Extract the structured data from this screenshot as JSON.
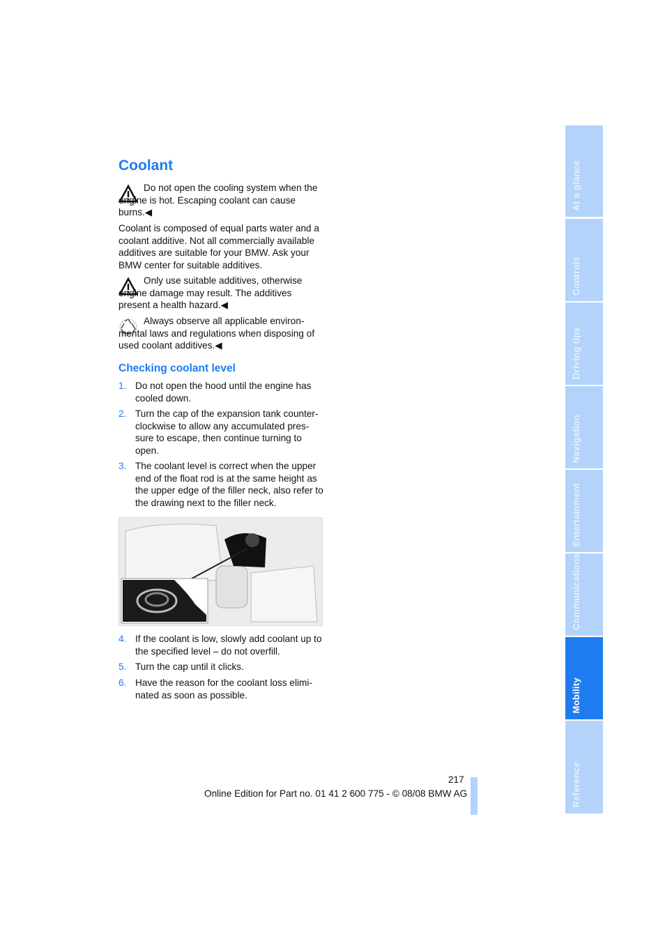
{
  "title": "Coolant",
  "warning1": "Do not open the cooling system when the engine is hot. Escaping coolant can cause burns.◀",
  "para1": "Coolant is composed of equal parts water and a coolant additive. Not all commercially available additives are suitable for your BMW. Ask your BMW center for suitable additives.",
  "warning2": "Only use suitable additives, otherwise engine damage may result. The additives present a health hazard.◀",
  "env_note": "Always observe all applicable environ­mental laws and regulations when dis­posing of used coolant additives.◀",
  "subtitle": "Checking coolant level",
  "steps": [
    {
      "n": "1.",
      "text": "Do not open the hood until the engine has cooled down."
    },
    {
      "n": "2.",
      "text": "Turn the cap of the expansion tank counter­clockwise to allow any accumulated pres­sure to escape, then continue turning to open."
    },
    {
      "n": "3.",
      "text": "The coolant level is correct when the upper end of the float rod is at the same height as the upper edge of the filler neck, also refer to the drawing next to the filler neck."
    },
    {
      "n": "4.",
      "text": "If the coolant is low, slowly add coolant up to the specified level – do not overfill."
    },
    {
      "n": "5.",
      "text": "Turn the cap until it clicks."
    },
    {
      "n": "6.",
      "text": "Have the reason for the coolant loss elimi­nated as soon as possible."
    }
  ],
  "page_number": "217",
  "footer": "Online Edition for Part no. 01 41 2 600 775 - © 08/08 BMW AG",
  "tabs": [
    {
      "label": "At a glance",
      "active": false
    },
    {
      "label": "Controls",
      "active": false
    },
    {
      "label": "Driving tips",
      "active": false
    },
    {
      "label": "Navigation",
      "active": false
    },
    {
      "label": "Entertainment",
      "active": false
    },
    {
      "label": "Communications",
      "active": false
    },
    {
      "label": "Mobility",
      "active": true
    },
    {
      "label": "Reference",
      "active": false
    }
  ],
  "colors": {
    "accent": "#1f7cf0",
    "tab": "#b3d3fb"
  }
}
